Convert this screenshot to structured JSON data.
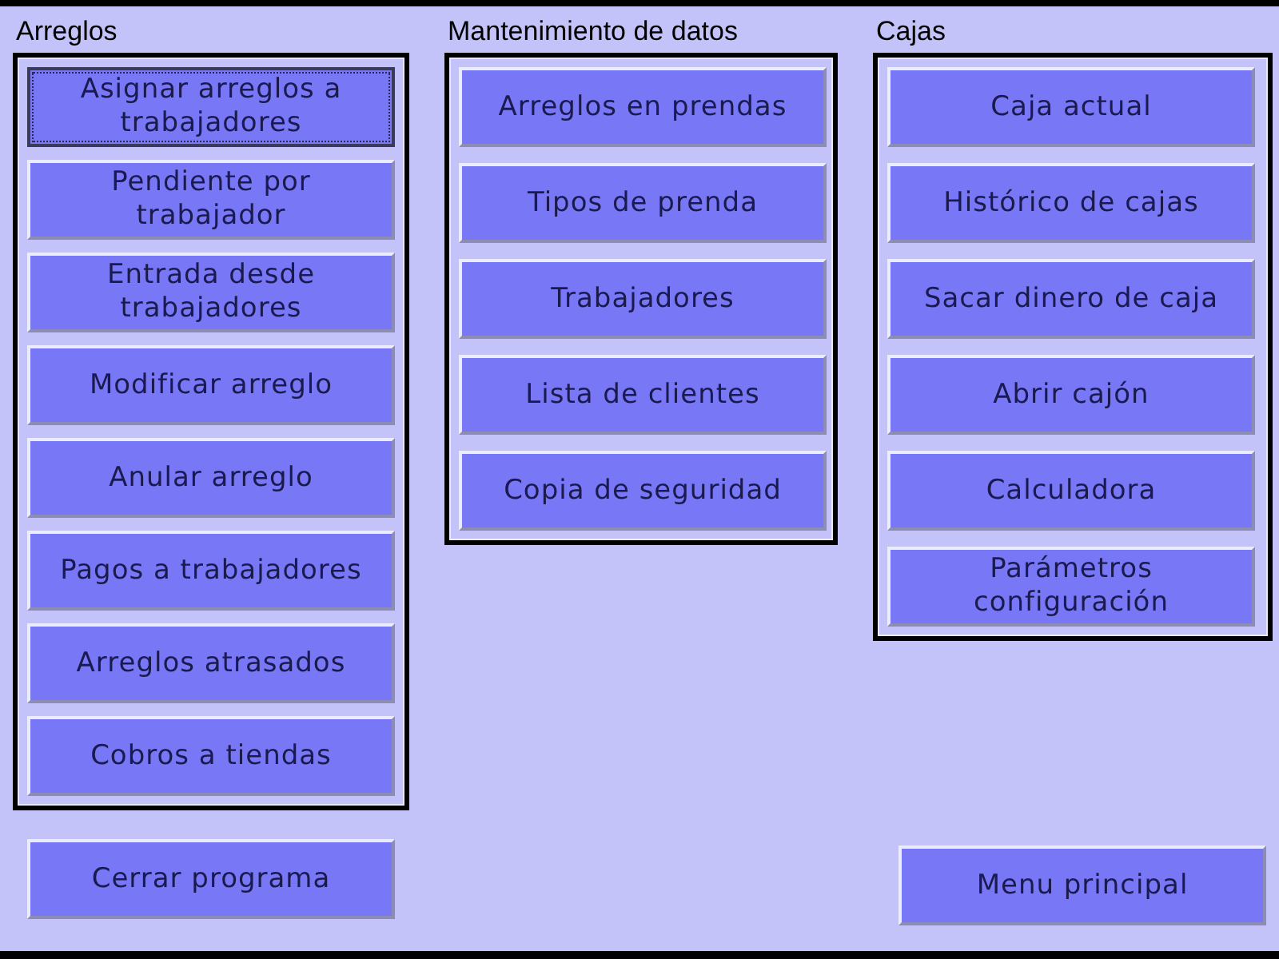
{
  "sections": [
    {
      "title": "Arreglos",
      "buttons": [
        {
          "label": "Asignar arreglos a trabajadores",
          "focused": true
        },
        {
          "label": "Pendiente por trabajador",
          "focused": false
        },
        {
          "label": "Entrada desde trabajadores",
          "focused": false
        },
        {
          "label": "Modificar arreglo",
          "focused": false
        },
        {
          "label": "Anular arreglo",
          "focused": false
        },
        {
          "label": "Pagos a trabajadores",
          "focused": false
        },
        {
          "label": "Arreglos atrasados",
          "focused": false
        },
        {
          "label": "Cobros a tiendas",
          "focused": false
        }
      ]
    },
    {
      "title": "Mantenimiento de datos",
      "buttons": [
        {
          "label": "Arreglos en prendas",
          "focused": false
        },
        {
          "label": "Tipos de prenda",
          "focused": false
        },
        {
          "label": "Trabajadores",
          "focused": false
        },
        {
          "label": "Lista de clientes",
          "focused": false
        },
        {
          "label": "Copia de seguridad",
          "focused": false
        }
      ]
    },
    {
      "title": "Cajas",
      "buttons": [
        {
          "label": "Caja actual",
          "focused": false
        },
        {
          "label": "Histórico de cajas",
          "focused": false
        },
        {
          "label": "Sacar dinero de caja",
          "focused": false
        },
        {
          "label": "Abrir cajón",
          "focused": false
        },
        {
          "label": "Calculadora",
          "focused": false
        },
        {
          "label": "Parámetros configuración",
          "focused": false
        }
      ]
    }
  ],
  "footer_buttons": [
    {
      "label": "Cerrar programa",
      "focused": false
    },
    {
      "label": "Menu principal",
      "focused": false
    }
  ]
}
